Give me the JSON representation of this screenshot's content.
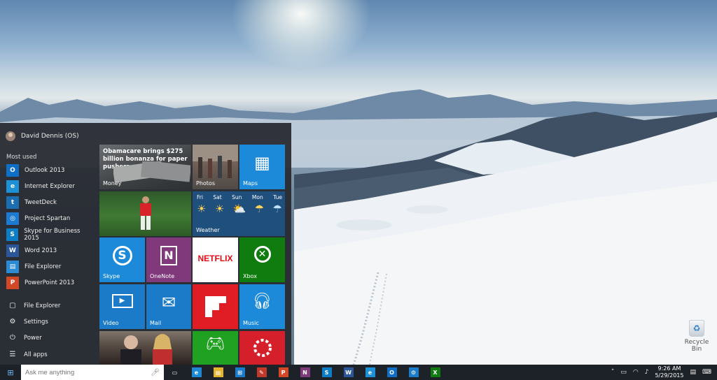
{
  "user": {
    "name": "David Dennis (OS)"
  },
  "most_used": {
    "label": "Most used",
    "items": [
      {
        "label": "Outlook 2013",
        "icon": "outlook-icon",
        "glyph": "O",
        "color": "#0f6fc6"
      },
      {
        "label": "Internet Explorer",
        "icon": "internet-explorer-icon",
        "glyph": "e",
        "color": "#1e90d6"
      },
      {
        "label": "TweetDeck",
        "icon": "tweetdeck-icon",
        "glyph": "t",
        "color": "#1b6fb0"
      },
      {
        "label": "Project Spartan",
        "icon": "globe-icon",
        "glyph": "◎",
        "color": "#1c7bd0"
      },
      {
        "label": "Skype for Business 2015",
        "icon": "skype-icon",
        "glyph": "S",
        "color": "#0d7ec5"
      },
      {
        "label": "Word 2013",
        "icon": "word-icon",
        "glyph": "W",
        "color": "#2b579a"
      },
      {
        "label": "File Explorer",
        "icon": "folder-icon",
        "glyph": "▤",
        "color": "#2a8ad4"
      },
      {
        "label": "PowerPoint 2013",
        "icon": "powerpoint-icon",
        "glyph": "P",
        "color": "#d24726"
      }
    ]
  },
  "system_items": [
    {
      "label": "File Explorer",
      "icon": "folder-icon",
      "glyph": "▢"
    },
    {
      "label": "Settings",
      "icon": "gear-icon",
      "glyph": "⚙"
    },
    {
      "label": "Power",
      "icon": "power-icon",
      "glyph": "⏻"
    },
    {
      "label": "All apps",
      "icon": "list-icon",
      "glyph": "☰"
    }
  ],
  "tiles": {
    "money": {
      "label": "Money",
      "headline": "Obamacare brings $275 billion bonanza for paper pushers"
    },
    "photos": {
      "label": "Photos"
    },
    "maps": {
      "label": "Maps",
      "color": "#1c8ad8"
    },
    "weather": {
      "label": "Weather",
      "days": [
        "Fri",
        "Sat",
        "Sun",
        "Mon",
        "Tue"
      ]
    },
    "skype": {
      "label": "Skype",
      "color": "#1c8ad8"
    },
    "onenote": {
      "label": "OneNote",
      "color": "#80397b"
    },
    "netflix": {
      "text": "NETFLIX",
      "color": "#e50914"
    },
    "xbox": {
      "label": "Xbox",
      "color": "#107c10"
    },
    "video": {
      "label": "Video",
      "color": "#1c7bc8"
    },
    "mail": {
      "label": "Mail",
      "color": "#1c7bc8"
    },
    "flipboard": {
      "color": "#e01c24"
    },
    "music": {
      "label": "Music",
      "color": "#1c8ad8"
    },
    "games": {
      "color": "#21a121"
    },
    "groove": {
      "color": "#d51f2b"
    }
  },
  "taskbar": {
    "search_placeholder": "Ask me anything",
    "apps": [
      {
        "name": "task-view-icon",
        "glyph": "▭",
        "color": "transparent"
      },
      {
        "name": "ie-taskbar-icon",
        "glyph": "e",
        "color": "#1e88d4"
      },
      {
        "name": "file-explorer-taskbar-icon",
        "glyph": "▤",
        "color": "#e3b52e"
      },
      {
        "name": "store-taskbar-icon",
        "glyph": "⊞",
        "color": "#1c7bc8"
      },
      {
        "name": "paint-taskbar-icon",
        "glyph": "✎",
        "color": "#c0392b"
      },
      {
        "name": "powerpoint-taskbar-icon",
        "glyph": "P",
        "color": "#d24726"
      },
      {
        "name": "onenote-taskbar-icon",
        "glyph": "N",
        "color": "#80397b"
      },
      {
        "name": "skype-taskbar-icon",
        "glyph": "S",
        "color": "#0d7ec5"
      },
      {
        "name": "word-taskbar-icon",
        "glyph": "W",
        "color": "#2b579a"
      },
      {
        "name": "edge-taskbar-icon",
        "glyph": "e",
        "color": "#1e90d6"
      },
      {
        "name": "outlook-taskbar-icon",
        "glyph": "O",
        "color": "#0f6fc6"
      },
      {
        "name": "settings-taskbar-icon",
        "glyph": "⚙",
        "color": "#1c7bc8"
      },
      {
        "name": "xbox-taskbar-icon",
        "glyph": "X",
        "color": "#107c10"
      }
    ],
    "time": "9:26 AM",
    "date": "5/29/2015"
  },
  "desktop": {
    "recycle_bin_label": "Recycle Bin"
  }
}
